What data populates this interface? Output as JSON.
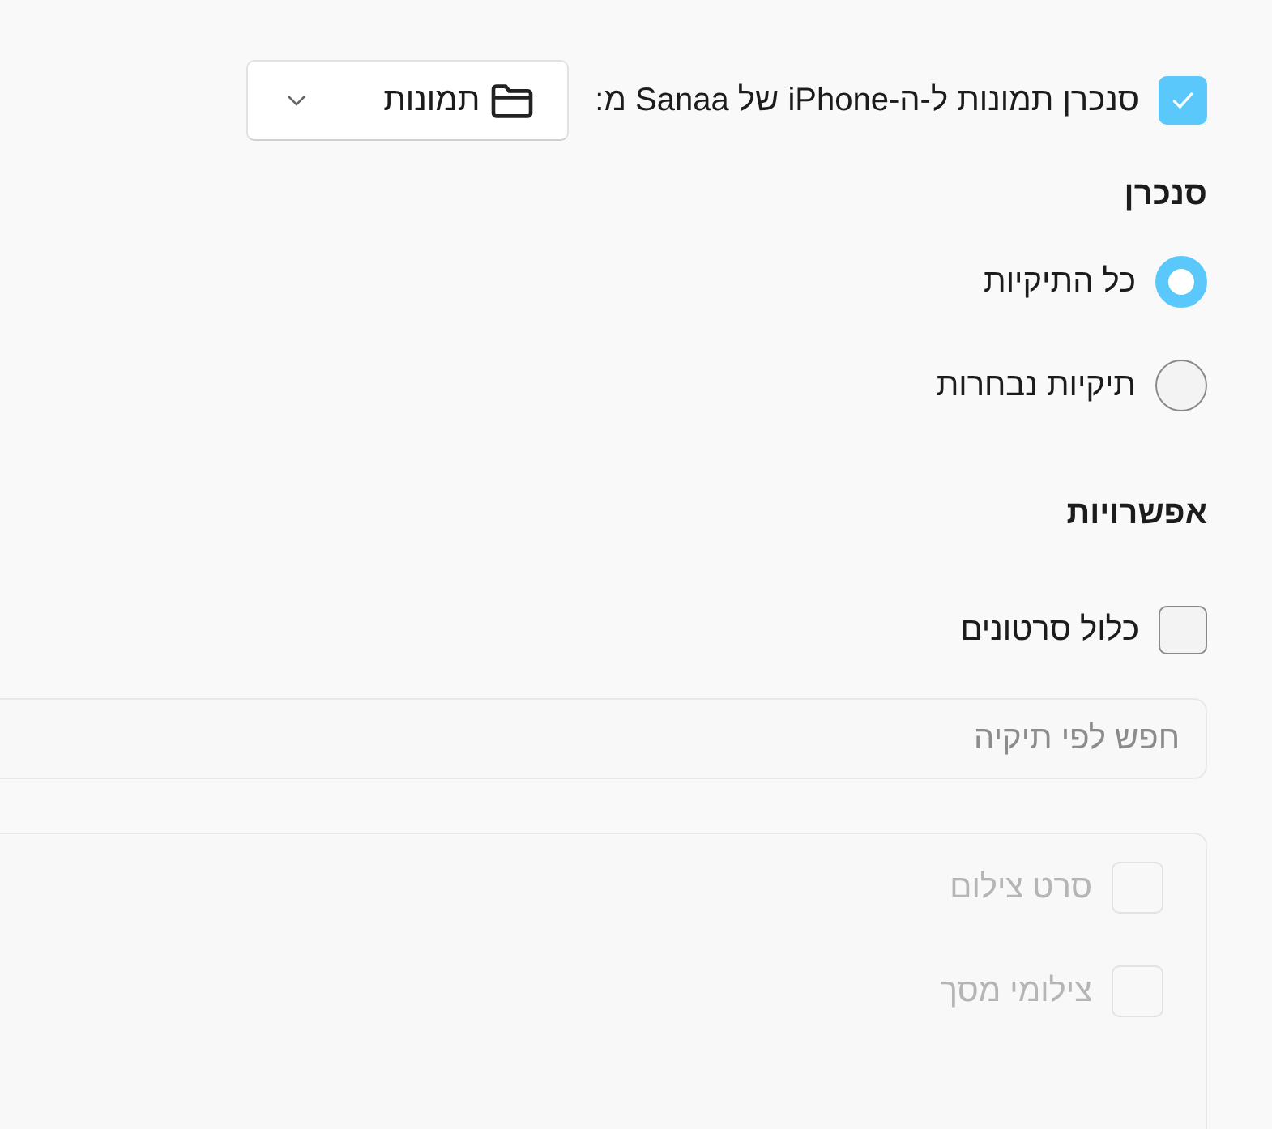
{
  "sync": {
    "checked": true,
    "label": "סנכרן תמונות ל-ה-iPhone של Sanaa מ:",
    "source": "תמונות"
  },
  "sync_section": {
    "title": "סנכרן",
    "options": [
      {
        "label": "כל התיקיות",
        "selected": true
      },
      {
        "label": "תיקיות נבחרות",
        "selected": false
      }
    ]
  },
  "options_section": {
    "title": "אפשרויות",
    "items": [
      {
        "label": "כלול סרטונים",
        "checked": false
      }
    ]
  },
  "search": {
    "placeholder": "חפש לפי תיקיה"
  },
  "folders": [
    {
      "label": "סרט צילום",
      "checked": false,
      "disabled": true
    },
    {
      "label": "צילומי מסך",
      "checked": false,
      "disabled": true
    }
  ]
}
